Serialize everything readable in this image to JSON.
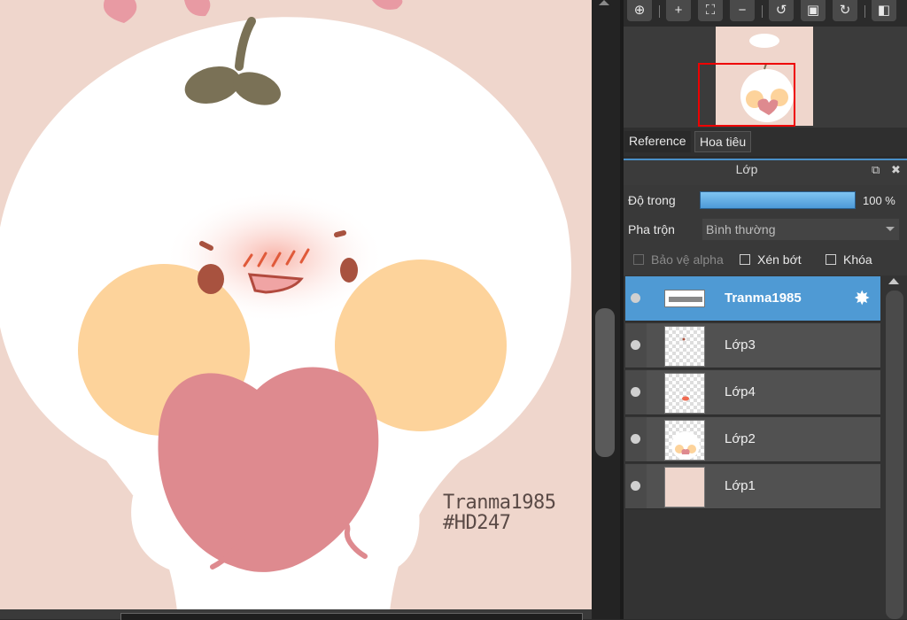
{
  "canvas": {
    "watermark_line1": "Tranma1985",
    "watermark_line2": "#HD247"
  },
  "toolbar": {
    "buttons": [
      {
        "name": "zoom-actual-icon",
        "glyph": "🔍"
      },
      {
        "name": "zoom-in-icon",
        "glyph": "+"
      },
      {
        "name": "fit-screen-icon",
        "glyph": "⛶"
      },
      {
        "name": "zoom-out-icon",
        "glyph": "−"
      },
      {
        "name": "rotate-left-icon",
        "glyph": "↺"
      },
      {
        "name": "fullscreen-icon",
        "glyph": "▣"
      },
      {
        "name": "rotate-right-icon",
        "glyph": "↻"
      },
      {
        "name": "flip-icon",
        "glyph": "◧"
      }
    ]
  },
  "tabs": {
    "reference": "Reference",
    "navigator": "Hoa tiêu"
  },
  "layer_panel": {
    "title": "Lớp",
    "opacity_label": "Độ trong",
    "opacity_value": "100 %",
    "opacity_fraction": 1.0,
    "blend_label": "Pha trộn",
    "blend_value": "Bình thường",
    "protect_alpha_label": "Bảo vệ alpha",
    "clipping_label": "Xén bớt",
    "lock_label": "Khóa"
  },
  "layers": [
    {
      "name": "Tranma1985",
      "active": true
    },
    {
      "name": "Lớp3",
      "active": false
    },
    {
      "name": "Lớp4",
      "active": false
    },
    {
      "name": "Lớp2",
      "active": false
    },
    {
      "name": "Lớp1",
      "active": false
    }
  ],
  "colors": {
    "accent": "#4f9ad4",
    "canvas_bg": "#efd6cc",
    "cheek": "#fdd39b",
    "heart": "#de8a8f"
  }
}
